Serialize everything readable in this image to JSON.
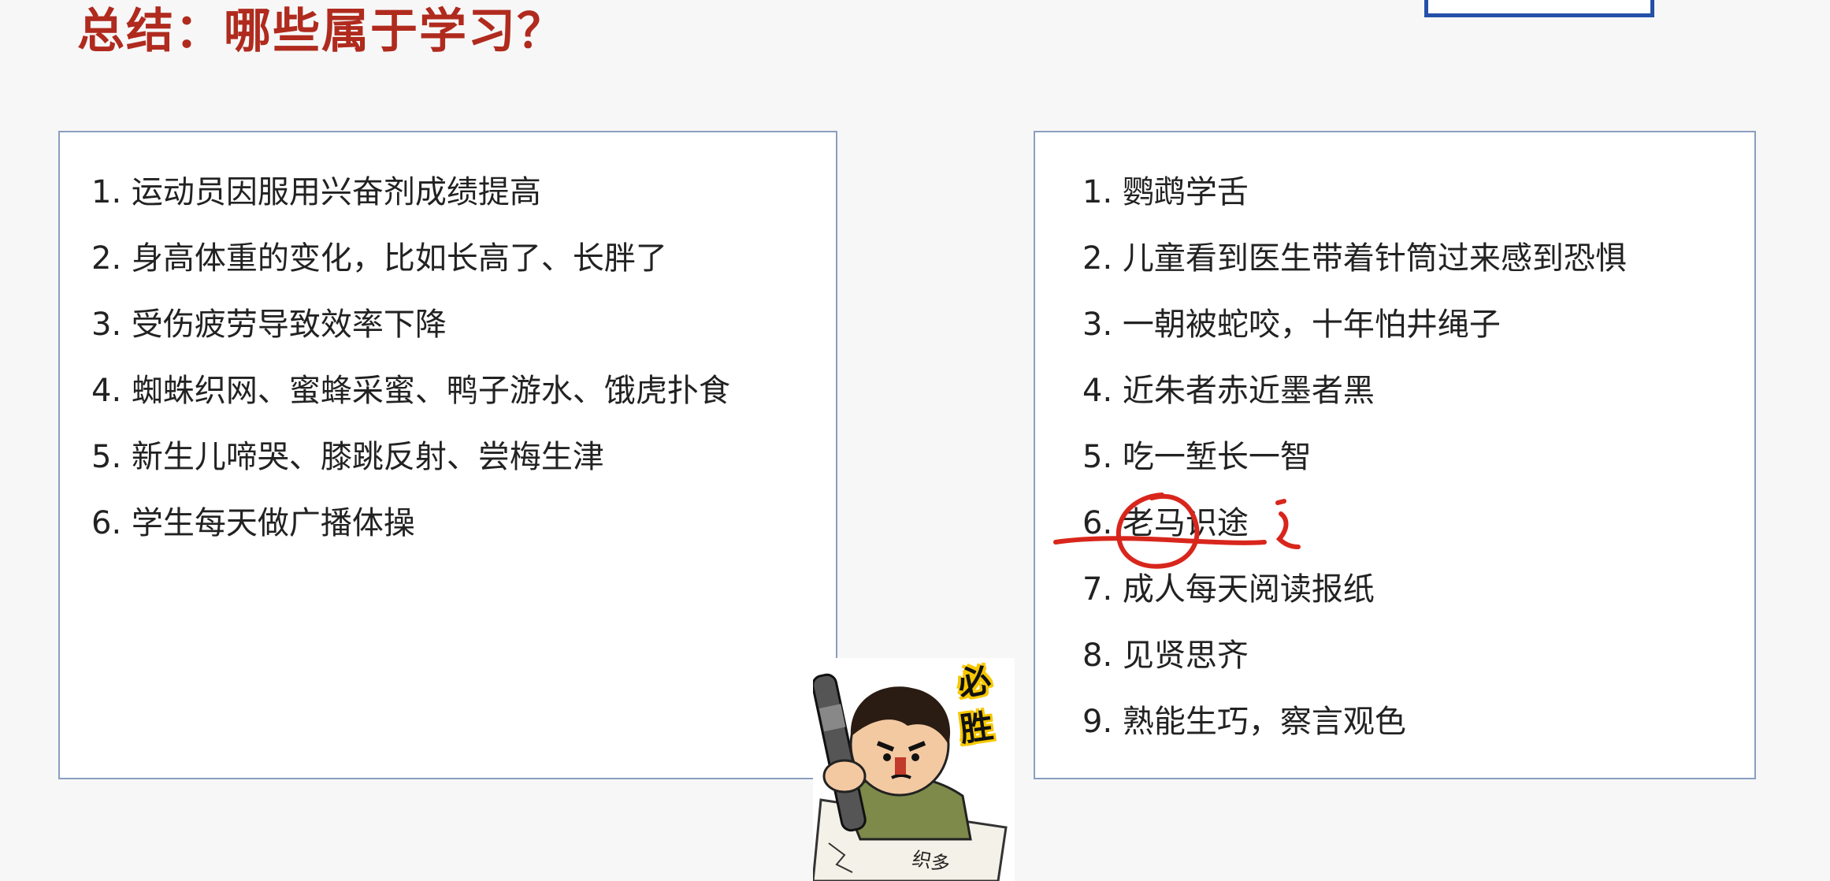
{
  "title": "总结：哪些属于学习？",
  "left_list": [
    "1. 运动员因服用兴奋剂成绩提高",
    "2. 身高体重的变化，比如长高了、长胖了",
    "3. 受伤疲劳导致效率下降",
    "4. 蜘蛛织网、蜜蜂采蜜、鸭子游水、饿虎扑食",
    "5. 新生儿啼哭、膝跳反射、尝梅生津",
    "6. 学生每天做广播体操"
  ],
  "right_list": [
    "1. 鹦鹉学舌",
    "2. 儿童看到医生带着针筒过来感到恐惧",
    "3. 一朝被蛇咬，十年怕井绳子",
    "4. 近朱者赤近墨者黑",
    "5. 吃一堑长一智",
    "6. 老马识途",
    "7. 成人每天阅读报纸",
    "8. 见贤思齐",
    "9. 熟能生巧，察言观色"
  ],
  "sticker": {
    "char1": "必",
    "char2": "胜",
    "paper_text": "织多"
  },
  "colors": {
    "title": "#b02a1e",
    "annotation": "#d8261c",
    "panel_border": "#8a9fc0",
    "sticker_outline": "#f6c800"
  }
}
